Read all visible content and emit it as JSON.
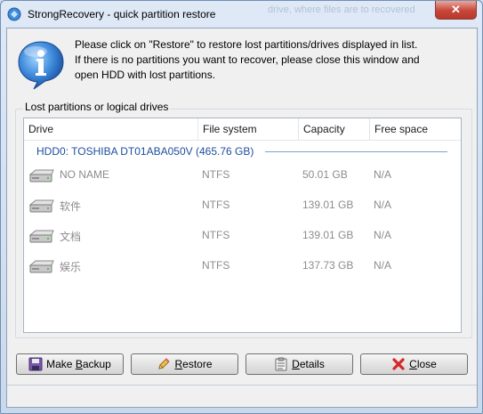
{
  "window": {
    "title": "StrongRecovery - quick partition restore",
    "background_title_fragment": "drive, where files are to   recovered"
  },
  "message": "Please click on \"Restore\" to restore lost partitions/drives displayed in list.\nIf there is no partitions you want to recover, please close this window and\nopen HDD with lost partitions.",
  "group_label": "Lost partitions or logical drives",
  "columns": [
    "Drive",
    "File system",
    "Capacity",
    "Free space"
  ],
  "disk": "HDD0: TOSHIBA DT01ABA050V (465.76 GB)",
  "partitions": [
    {
      "name": "NO NAME",
      "fs": "NTFS",
      "capacity": "50.01 GB",
      "free": "N/A"
    },
    {
      "name": "软件",
      "fs": "NTFS",
      "capacity": "139.01 GB",
      "free": "N/A"
    },
    {
      "name": "文档",
      "fs": "NTFS",
      "capacity": "139.01 GB",
      "free": "N/A"
    },
    {
      "name": "娱乐",
      "fs": "NTFS",
      "capacity": "137.73 GB",
      "free": "N/A"
    }
  ],
  "buttons": {
    "backup": {
      "prefix": "Make ",
      "accel": "B",
      "rest": "ackup"
    },
    "restore": {
      "prefix": "",
      "accel": "R",
      "rest": "estore"
    },
    "details": {
      "prefix": "",
      "accel": "D",
      "rest": "etails"
    },
    "close": {
      "prefix": "",
      "accel": "C",
      "rest": "lose"
    }
  },
  "icons": {
    "app": "app-icon",
    "close": "close-icon",
    "info": "info-icon",
    "drive": "hard-drive-icon",
    "backup": "floppy-disk-icon",
    "restore": "pencil-icon",
    "details": "clipboard-icon",
    "close_btn": "red-x-icon"
  }
}
